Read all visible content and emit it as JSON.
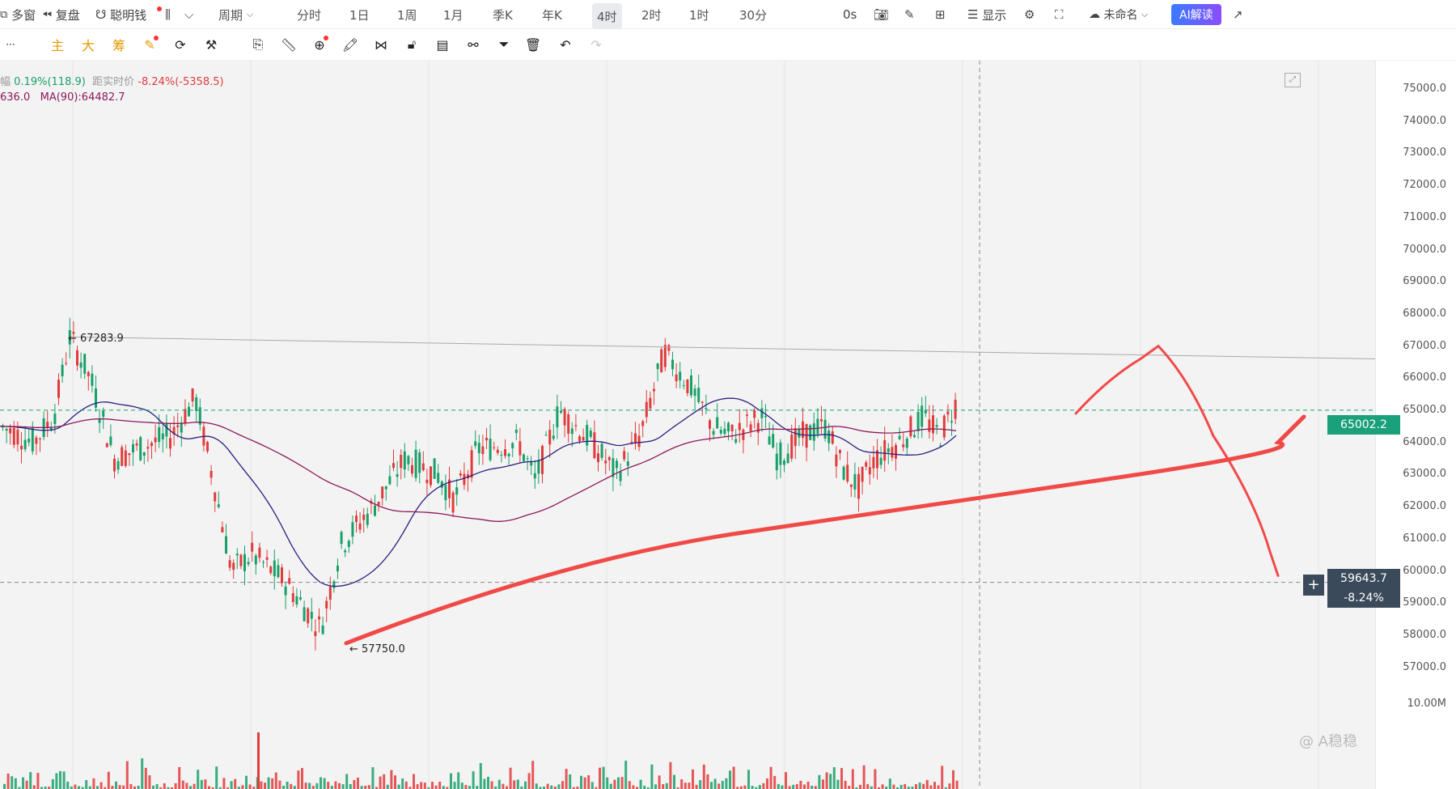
{
  "toolbar": {
    "multi_window": "多窗",
    "replay": "复盘",
    "smart_money": "聪明钱",
    "period": "周期",
    "periods": [
      "分时",
      "1日",
      "1周",
      "1月",
      "季K",
      "年K",
      "4时",
      "2时",
      "1时",
      "30分"
    ],
    "active_period": "4时",
    "seconds": "0s",
    "display": "显示",
    "layout_name": "未命名",
    "ai_button": "AI解读"
  },
  "toolbar2": {
    "more": "···",
    "main": "主",
    "big": "大",
    "chips": "筹"
  },
  "indicators": {
    "change_prefix": "幅",
    "change_value": "0.19%(118.9)",
    "distance_label": "距实时价",
    "distance_value": "-8.24%(-5358.5)",
    "ma_prefix": "636.0",
    "ma90": "MA(90):64482.7"
  },
  "y_axis": {
    "labels": [
      "75000.0",
      "74000.0",
      "73000.0",
      "72000.0",
      "71000.0",
      "70000.0",
      "69000.0",
      "68000.0",
      "67000.0",
      "66000.0",
      "65000.0",
      "64000.0",
      "63000.0",
      "62000.0",
      "61000.0",
      "60000.0",
      "59000.0",
      "58000.0",
      "57000.0"
    ],
    "volume_label": "10.00M"
  },
  "price_tags": {
    "current": "65002.2",
    "crosshair_price": "59643.7",
    "crosshair_pct": "-8.24%"
  },
  "annotations": {
    "high": "← 67283.9",
    "low": "← 57750.0"
  },
  "watermark": "@ A稳稳",
  "colors": {
    "up": "#18a06a",
    "down": "#e23b3b",
    "ma_short": "#2a2080",
    "ma_long": "#8b1a5a",
    "drawing": "#f04a48",
    "current_line": "#1aa07a"
  }
}
